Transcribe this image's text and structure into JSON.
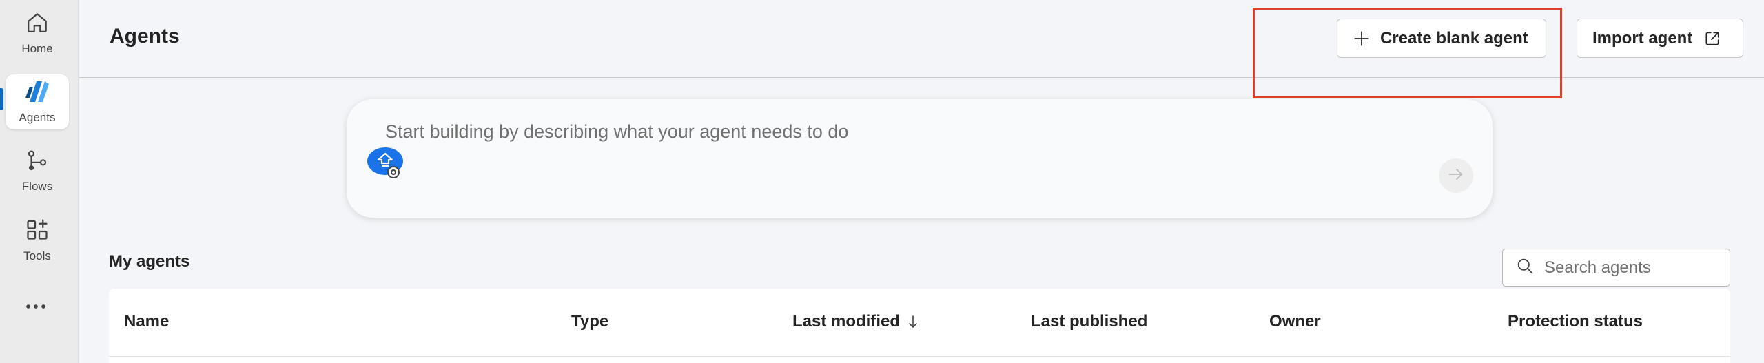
{
  "nav": {
    "items": [
      {
        "label": "Home",
        "icon": "home-icon"
      },
      {
        "label": "Agents",
        "icon": "agents-icon",
        "active": true
      },
      {
        "label": "Flows",
        "icon": "flows-icon"
      },
      {
        "label": "Tools",
        "icon": "tools-icon"
      }
    ],
    "more_icon": "more-icon"
  },
  "header": {
    "title": "Agents",
    "create_label": "Create blank agent",
    "import_label": "Import agent"
  },
  "prompt": {
    "placeholder": "Start building by describing what your agent needs to do"
  },
  "my_agents": {
    "title": "My agents",
    "search_placeholder": "Search agents",
    "columns": [
      "Name",
      "Type",
      "Last modified",
      "Last published",
      "Owner",
      "Protection status"
    ],
    "sorted_column": "Last modified",
    "sort_direction": "descending"
  },
  "colors": {
    "accent": "#0f6cbd",
    "highlight": "#e2402a",
    "badge": "#1a73e8"
  }
}
